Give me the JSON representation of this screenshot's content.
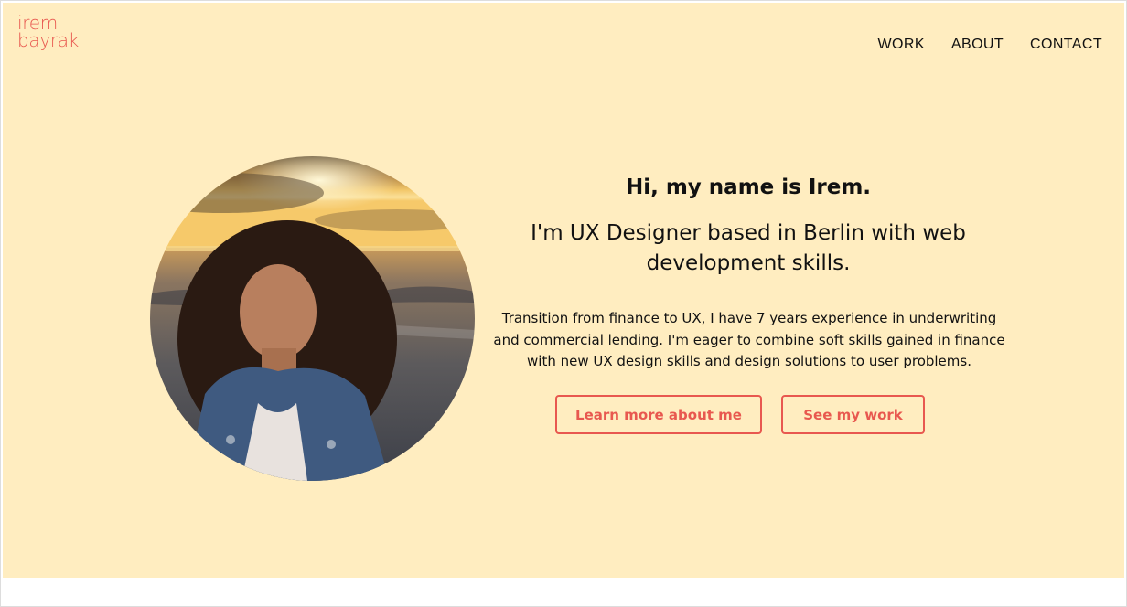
{
  "logo": {
    "line1": "irem",
    "line2": "bayrak"
  },
  "nav": {
    "items": [
      {
        "label": "WORK"
      },
      {
        "label": "ABOUT"
      },
      {
        "label": "CONTACT"
      }
    ]
  },
  "hero": {
    "greeting": "Hi, my name is Irem.",
    "tagline": "I'm UX Designer based in Berlin with web development skills.",
    "bio": "Transition from finance to UX, I have 7 years experience in underwriting and commercial lending. I'm eager to combine soft skills gained in finance with new UX design skills and design solutions to user problems.",
    "buttons": {
      "about": "Learn more about me",
      "work": "See my work"
    }
  },
  "colors": {
    "background": "#ffedc0",
    "accent": "#e8584f",
    "text": "#111111"
  }
}
